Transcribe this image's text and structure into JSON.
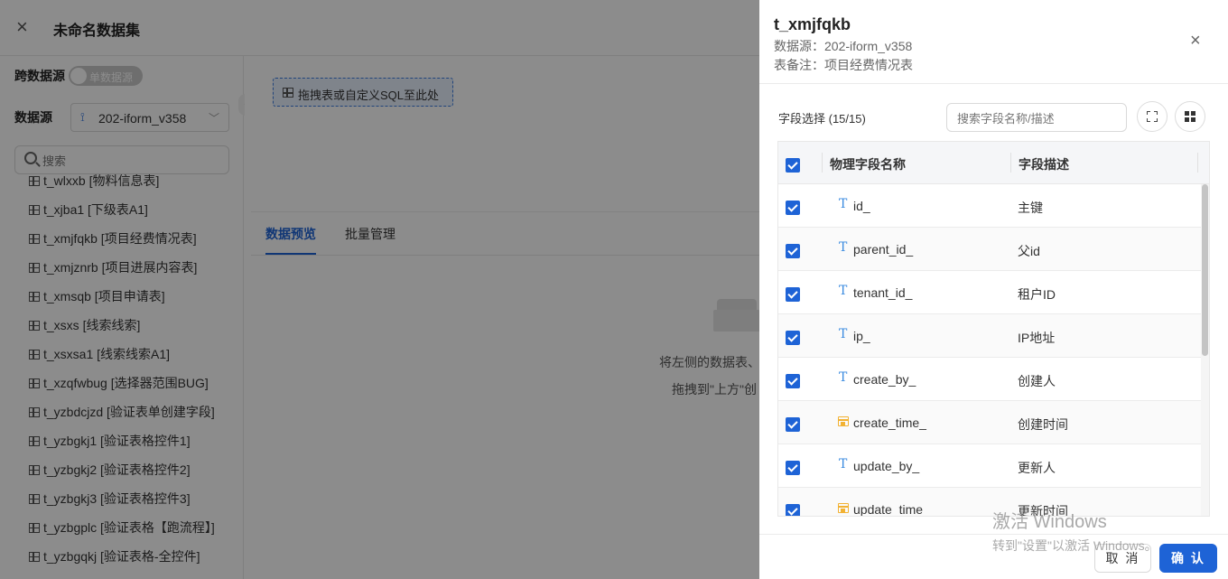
{
  "header": {
    "title": "未命名数据集"
  },
  "left": {
    "cross_label": "跨数据源",
    "toggle_text": "单数据源",
    "datasource_label": "数据源",
    "datasource_value": "202-iform_v358",
    "search_placeholder": "搜索",
    "tables": [
      "t_wlxxb [物料信息表]",
      "t_xjba1 [下级表A1]",
      "t_xmjfqkb [项目经费情况表]",
      "t_xmjznrb [项目进展内容表]",
      "t_xmsqb [项目申请表]",
      "t_xsxs [线索线索]",
      "t_xsxsa1 [线索线索A1]",
      "t_xzqfwbug [选择器范围BUG]",
      "t_yzbdcjzd [验证表单创建字段]",
      "t_yzbgkj1 [验证表格控件1]",
      "t_yzbgkj2 [验证表格控件2]",
      "t_yzbgkj3 [验证表格控件3]",
      "t_yzbgplc [验证表格【跑流程】]",
      "t_yzbgqkj [验证表格-全控件]"
    ]
  },
  "canvas": {
    "drop_hint": "拖拽表或自定义SQL至此处"
  },
  "preview": {
    "tabs": [
      "数据预览",
      "批量管理"
    ],
    "empty_line1": "将左侧的数据表、",
    "empty_line2": "拖拽到\"上方\"创"
  },
  "drawer": {
    "title": "t_xmjfqkb",
    "datasource_line": "数据源：202-iform_v358",
    "remark_line": "表备注：项目经费情况表",
    "field_select_label": "字段选择 (15/15)",
    "field_search_placeholder": "搜索字段名称/描述",
    "columns": {
      "name": "物理字段名称",
      "desc": "字段描述"
    },
    "fields": [
      {
        "name": "id_",
        "desc": "主键",
        "type": "text"
      },
      {
        "name": "parent_id_",
        "desc": "父id",
        "type": "text"
      },
      {
        "name": "tenant_id_",
        "desc": "租户ID",
        "type": "text"
      },
      {
        "name": "ip_",
        "desc": "IP地址",
        "type": "text"
      },
      {
        "name": "create_by_",
        "desc": "创建人",
        "type": "text"
      },
      {
        "name": "create_time_",
        "desc": "创建时间",
        "type": "date"
      },
      {
        "name": "update_by_",
        "desc": "更新人",
        "type": "text"
      },
      {
        "name": "update_time_",
        "desc": "更新时间",
        "type": "date"
      }
    ],
    "cancel_label": "取 消",
    "ok_label": "确 认"
  },
  "watermark": {
    "line1": "激活 Windows",
    "line2": "转到\"设置\"以激活 Windows。"
  }
}
